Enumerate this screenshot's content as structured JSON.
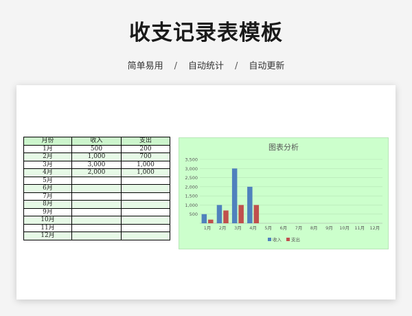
{
  "page": {
    "title": "收支记录表模板",
    "features": [
      "简单易用",
      "自动统计",
      "自动更新"
    ],
    "separator": "/"
  },
  "table": {
    "headers": [
      "月份",
      "收入",
      "支出"
    ],
    "rows": [
      {
        "month": "1月",
        "income": "500",
        "expense": "200"
      },
      {
        "month": "2月",
        "income": "1,000",
        "expense": "700"
      },
      {
        "month": "3月",
        "income": "3,000",
        "expense": "1,000"
      },
      {
        "month": "4月",
        "income": "2,000",
        "expense": "1,000"
      },
      {
        "month": "5月",
        "income": "",
        "expense": ""
      },
      {
        "month": "6月",
        "income": "",
        "expense": ""
      },
      {
        "month": "7月",
        "income": "",
        "expense": ""
      },
      {
        "month": "8月",
        "income": "",
        "expense": ""
      },
      {
        "month": "9月",
        "income": "",
        "expense": ""
      },
      {
        "month": "10月",
        "income": "",
        "expense": ""
      },
      {
        "month": "11月",
        "income": "",
        "expense": ""
      },
      {
        "month": "12月",
        "income": "",
        "expense": ""
      }
    ]
  },
  "chart_data": {
    "type": "bar",
    "title": "图表分析",
    "categories": [
      "1月",
      "2月",
      "3月",
      "4月",
      "5月",
      "6月",
      "7月",
      "8月",
      "9月",
      "10月",
      "11月",
      "12月"
    ],
    "series": [
      {
        "name": "收入",
        "color": "#4f81bd",
        "values": [
          500,
          1000,
          3000,
          2000,
          0,
          0,
          0,
          0,
          0,
          0,
          0,
          0
        ]
      },
      {
        "name": "支出",
        "color": "#c0504d",
        "values": [
          200,
          700,
          1000,
          1000,
          0,
          0,
          0,
          0,
          0,
          0,
          0,
          0
        ]
      }
    ],
    "yticks": [
      "500",
      "1,000",
      "1,500",
      "2,000",
      "2,500",
      "3,000",
      "3,500"
    ],
    "ylim": [
      0,
      3500
    ],
    "grid": true,
    "legend": "bottom"
  }
}
